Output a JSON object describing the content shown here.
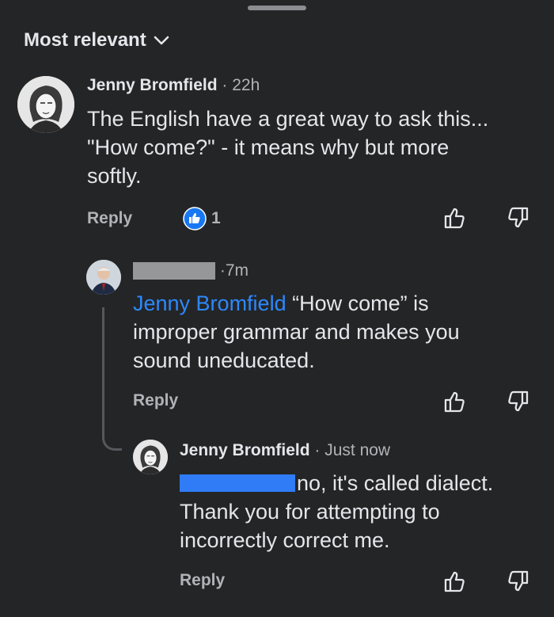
{
  "sort": {
    "label": "Most relevant"
  },
  "comments": [
    {
      "author": "Jenny Bromfield",
      "time": "22h",
      "text_lines": [
        "The English have a great way to ask this...",
        "\"How come?\" - it means why but more",
        "softly."
      ],
      "reply_label": "Reply",
      "reaction_count": "1"
    },
    {
      "author": "",
      "time": "7m",
      "mention": "Jenny Bromfield",
      "text_first": " “How come” is",
      "text_lines": [
        "improper grammar and makes you",
        "sound uneducated."
      ],
      "reply_label": "Reply"
    },
    {
      "author": "Jenny Bromfield",
      "time": "Just now",
      "text_first": "no, it's called dialect.",
      "text_lines": [
        "Thank you for attempting to",
        "incorrectly correct me."
      ],
      "reply_label": "Reply"
    }
  ],
  "colors": {
    "background": "#242526",
    "text": "#e4e6eb",
    "muted": "#b0b3b8",
    "mention": "#2d88ff",
    "like_badge": "#1877f2"
  },
  "icons": [
    "chevron-down-icon",
    "like-badge-icon",
    "thumbs-up-icon",
    "thumbs-down-icon"
  ]
}
